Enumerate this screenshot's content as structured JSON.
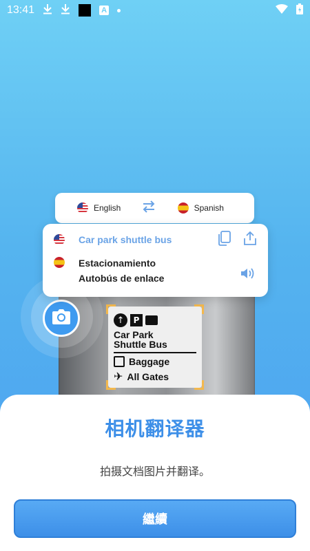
{
  "status_bar": {
    "time": "13:41",
    "icons": [
      "download-icon",
      "download-icon",
      "black-square-icon",
      "a-icon",
      "dot-icon",
      "wifi-icon",
      "battery-icon"
    ]
  },
  "language_bar": {
    "source_language": "English",
    "target_language": "Spanish",
    "swap_icon": "swap-arrows-icon"
  },
  "translation_card": {
    "source_text": "Car park shuttle bus",
    "target_text_line1": "Estacionamiento",
    "target_text_line2": "Autobús de enlace",
    "actions": [
      "copy-icon",
      "share-icon",
      "speaker-icon"
    ]
  },
  "sign": {
    "line1": "Car Park",
    "line2": "Shuttle Bus",
    "line3": "Baggage",
    "line4": "All Gates",
    "p_label": "P"
  },
  "sheet": {
    "title": "相机翻译器",
    "description": "拍摄文档图片并翻译。",
    "continue_label": "繼續"
  },
  "colors": {
    "accent": "#3d8fe8",
    "source_text": "#6aa3e6",
    "frame": "#f3b84d"
  }
}
